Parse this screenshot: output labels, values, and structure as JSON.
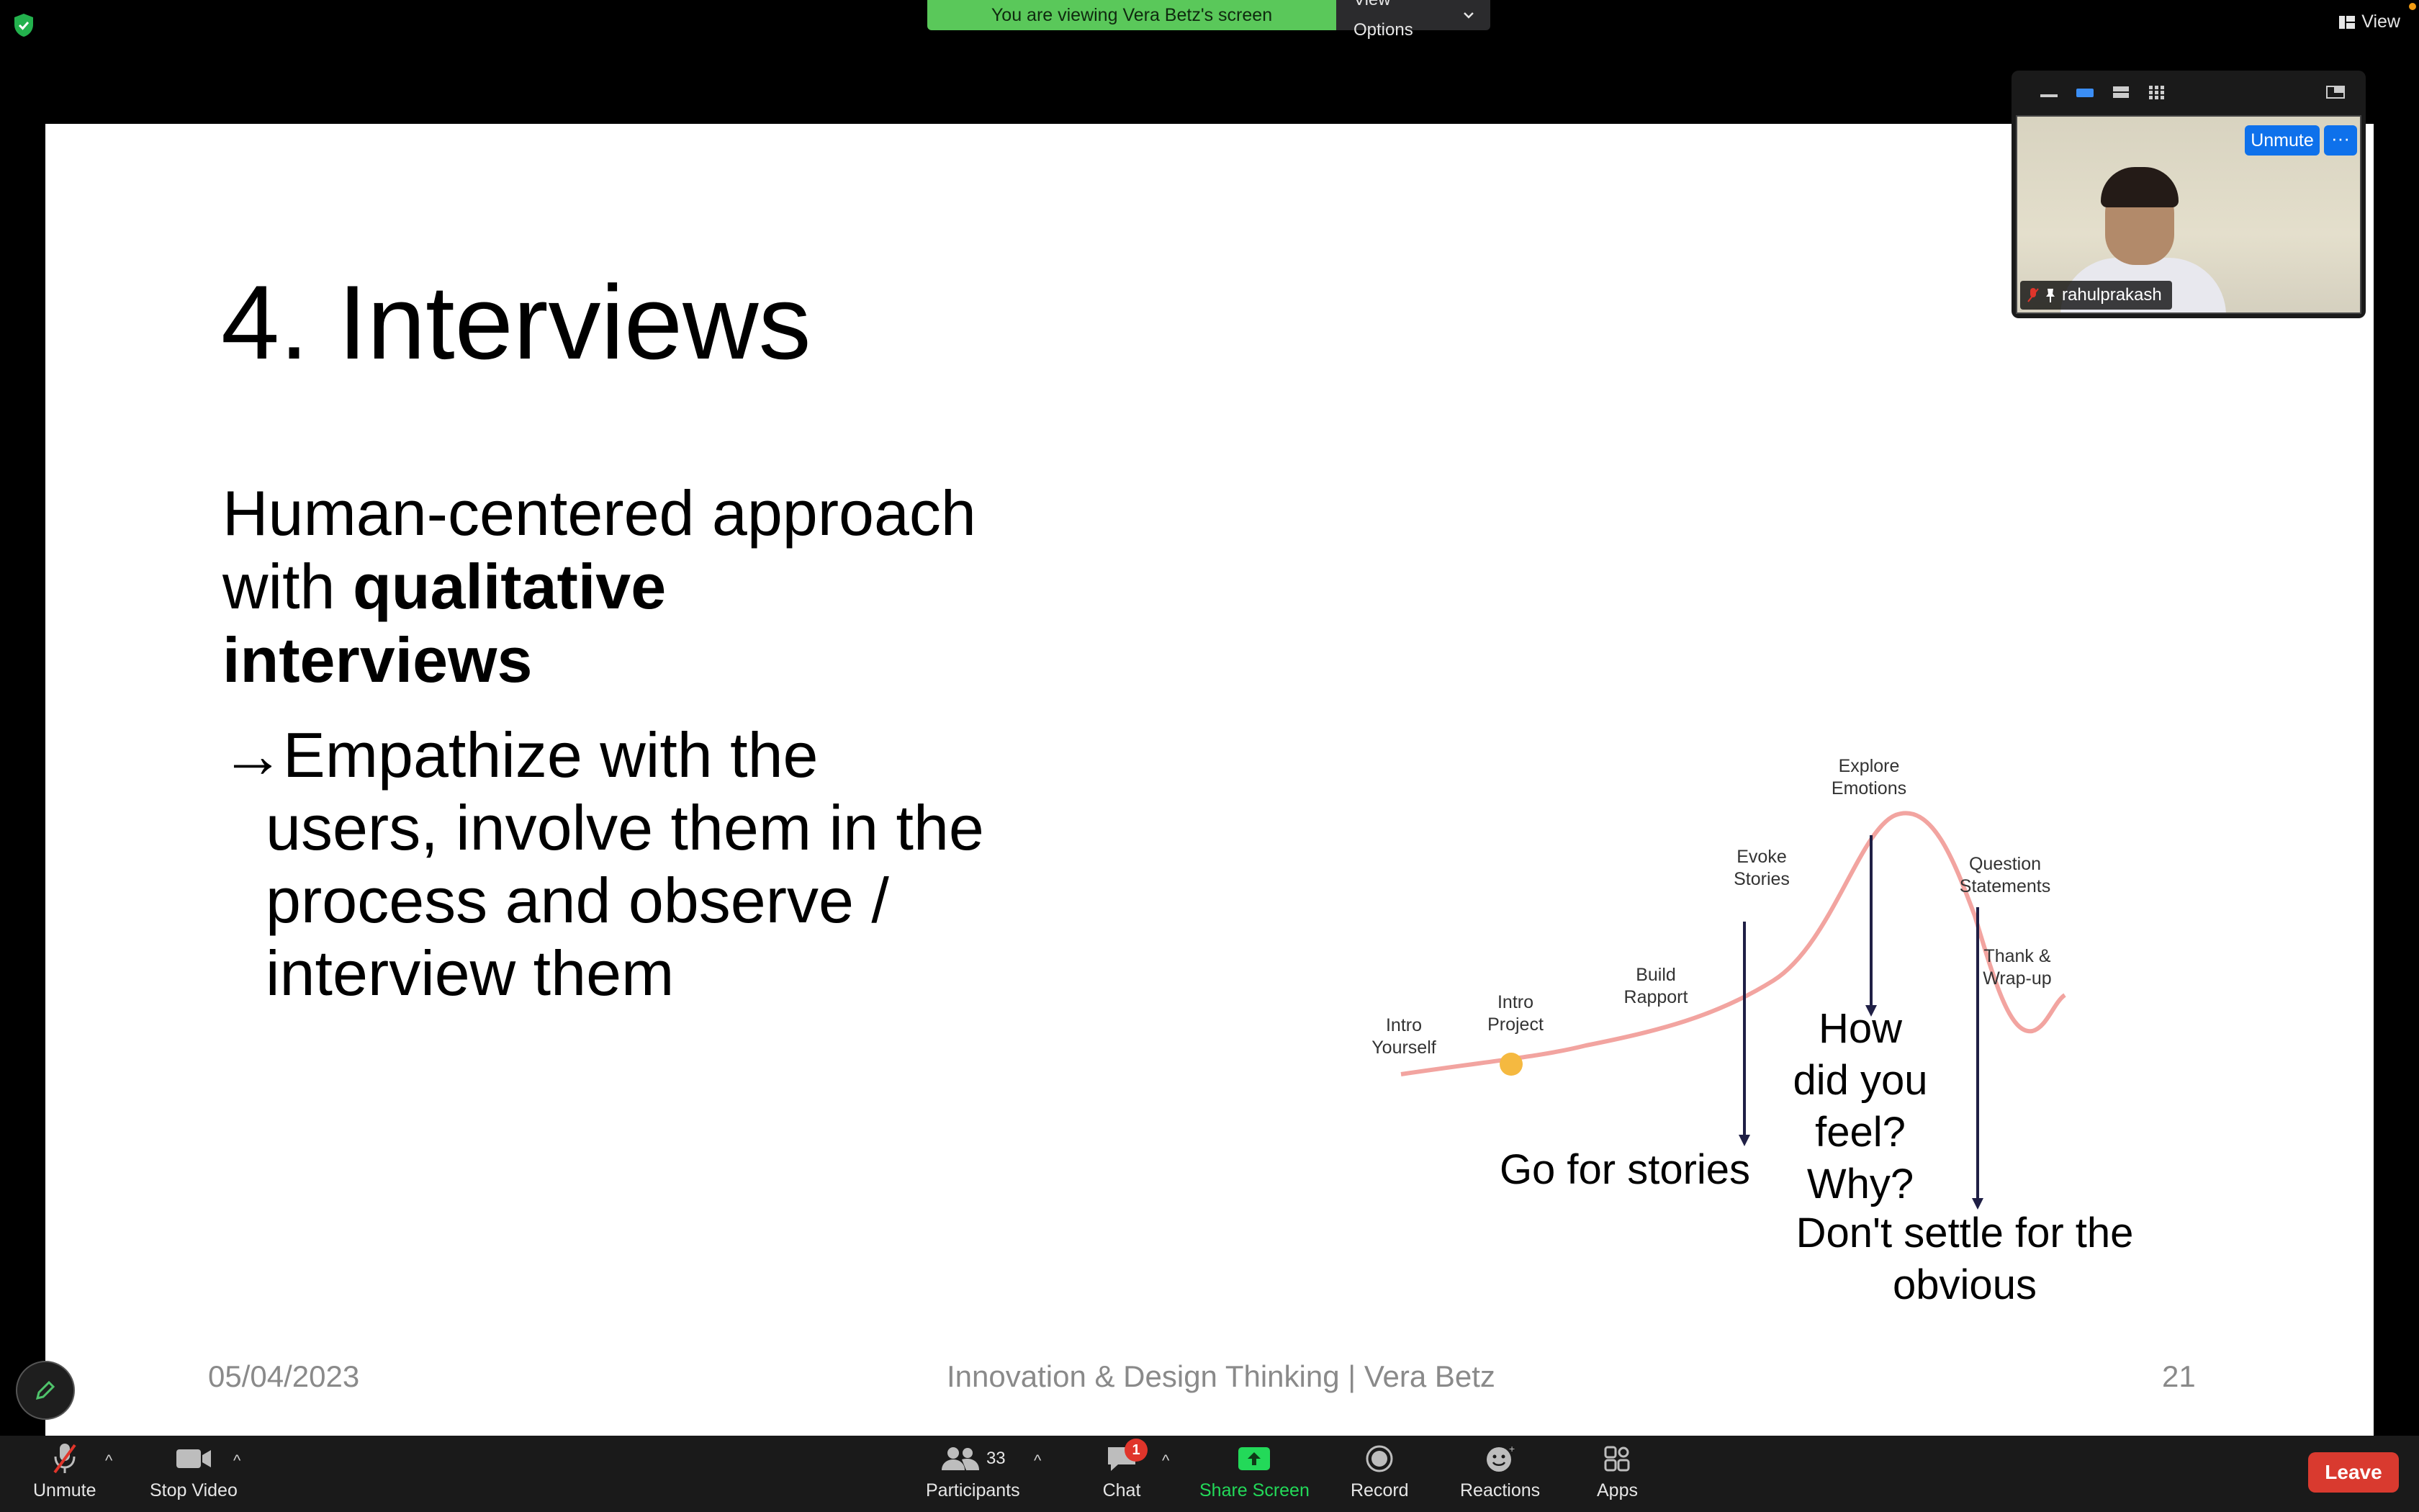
{
  "banner": {
    "text": "You are viewing Vera Betz's screen",
    "view_options": "View Options"
  },
  "view_button": "View",
  "slide": {
    "title": "4. Interviews",
    "headline_line1": "Human-centered approach",
    "headline_line2_plain": "with ",
    "headline_line2_bold": "qualitative",
    "headline_line3_bold": "interviews",
    "bullet_arrow": "→",
    "bullet_line1": "Empathize with the",
    "bullet_line2": "users, involve them in the",
    "bullet_line3": "process and observe /",
    "bullet_line4": "interview them",
    "diagram": {
      "stages": [
        {
          "line1": "Intro",
          "line2": "Yourself"
        },
        {
          "line1": "Intro",
          "line2": "Project"
        },
        {
          "line1": "Build",
          "line2": "Rapport"
        },
        {
          "line1": "Evoke",
          "line2": "Stories"
        },
        {
          "line1": "Explore",
          "line2": "Emotions"
        },
        {
          "line1": "Question",
          "line2": "Statements"
        },
        {
          "line1": "Thank &",
          "line2": "Wrap-up"
        }
      ],
      "callouts": {
        "stories": "Go for stories",
        "feel_1": "How",
        "feel_2": "did you",
        "feel_3": "feel?",
        "feel_4": "Why?",
        "settle_1": "Don't settle for the",
        "settle_2": "obvious"
      },
      "curve_color": "#f2a4a0",
      "marker_color": "#f5b940",
      "arrow_color": "#1f1f45"
    },
    "footer": {
      "date": "05/04/2023",
      "course": "Innovation & Design Thinking | Vera Betz",
      "page": "21"
    }
  },
  "video": {
    "participant_name": "rahulprakash",
    "unmute_label": "Unmute",
    "more_label": "···"
  },
  "toolbar": {
    "unmute": "Unmute",
    "stop_video": "Stop Video",
    "participants": "Participants",
    "participants_count": "33",
    "chat": "Chat",
    "chat_badge": "1",
    "share_screen": "Share Screen",
    "record": "Record",
    "reactions": "Reactions",
    "apps": "Apps",
    "leave": "Leave"
  },
  "colors": {
    "banner_green": "#5ac85a",
    "share_green": "#23d959",
    "zoom_blue": "#0e71eb",
    "leave_red": "#d93a2f"
  }
}
